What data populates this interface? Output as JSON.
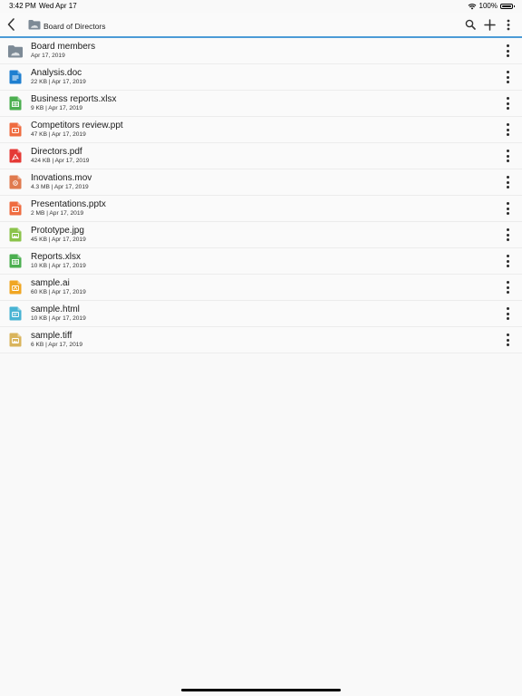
{
  "status_bar": {
    "time": "3:42 PM",
    "date": "Wed Apr 17",
    "battery": "100%"
  },
  "nav": {
    "title": "Board of Directors",
    "accent_color": "#4c9bd6"
  },
  "files": [
    {
      "name": "Board members",
      "meta": "Apr 17, 2019",
      "kind": "folder",
      "color": "#7d8a96"
    },
    {
      "name": "Analysis.doc",
      "meta": "22 KB | Apr 17, 2019",
      "kind": "doc",
      "color": "#1e7fd0"
    },
    {
      "name": "Business reports.xlsx",
      "meta": "9 KB | Apr 17, 2019",
      "kind": "sheet",
      "color": "#4caf50"
    },
    {
      "name": "Competitors review.ppt",
      "meta": "47 KB | Apr 17, 2019",
      "kind": "slides",
      "color": "#ef6c40"
    },
    {
      "name": "Directors.pdf",
      "meta": "424 KB | Apr 17, 2019",
      "kind": "pdf",
      "color": "#e53935"
    },
    {
      "name": "Inovations.mov",
      "meta": "4.3 MB | Apr 17, 2019",
      "kind": "video",
      "color": "#e07a4e"
    },
    {
      "name": "Presentations.pptx",
      "meta": "2 MB | Apr 17, 2019",
      "kind": "slides",
      "color": "#ef6c40"
    },
    {
      "name": "Prototype.jpg",
      "meta": "45 KB | Apr 17, 2019",
      "kind": "image",
      "color": "#8bc34a"
    },
    {
      "name": "Reports.xlsx",
      "meta": "10 KB | Apr 17, 2019",
      "kind": "sheet",
      "color": "#4caf50"
    },
    {
      "name": "sample.ai",
      "meta": "60 KB | Apr 17, 2019",
      "kind": "vector",
      "color": "#f0a623"
    },
    {
      "name": "sample.html",
      "meta": "10 KB | Apr 17, 2019",
      "kind": "code",
      "color": "#47b3d3"
    },
    {
      "name": "sample.tiff",
      "meta": "6 KB | Apr 17, 2019",
      "kind": "image",
      "color": "#d9b45c"
    }
  ]
}
